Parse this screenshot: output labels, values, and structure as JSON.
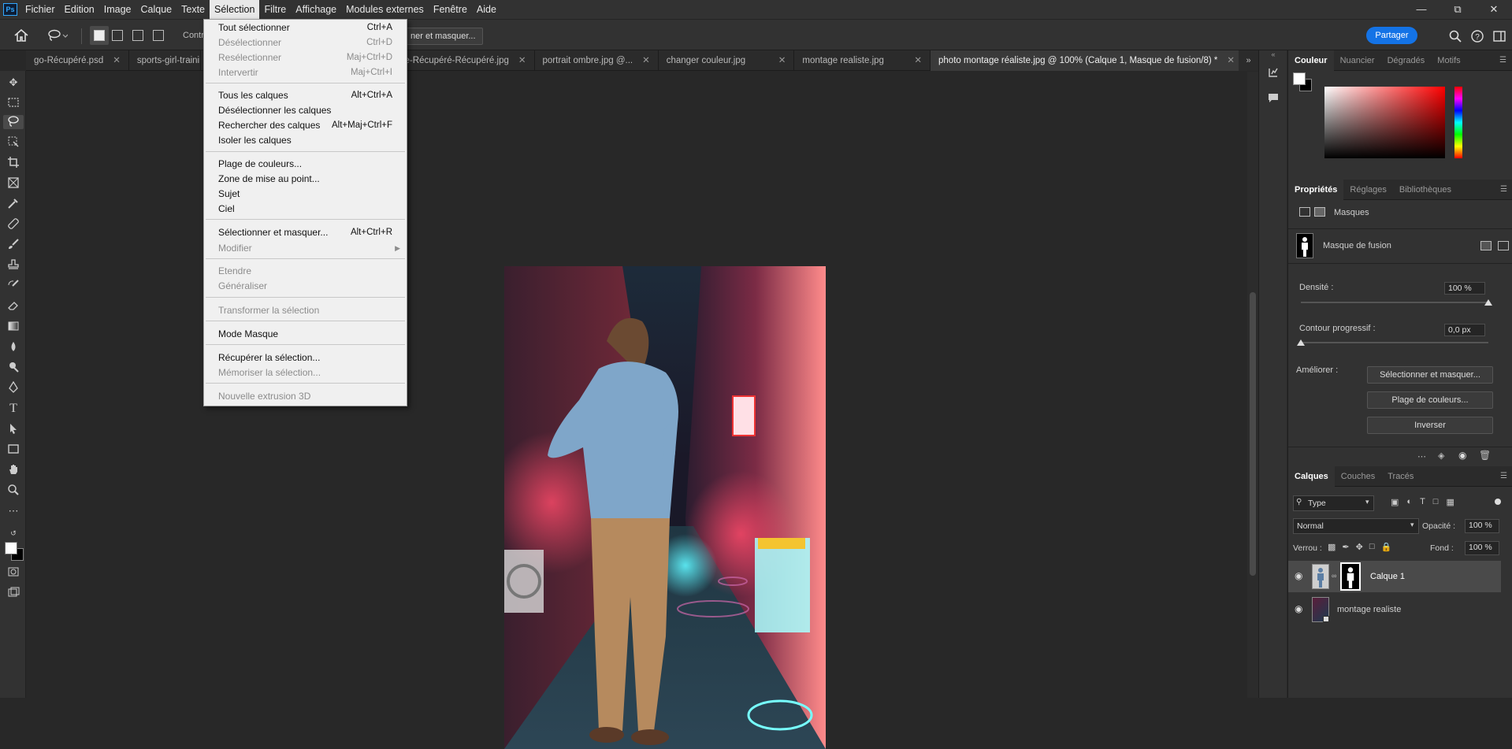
{
  "menubar": {
    "logo": "Ps",
    "items": [
      "Fichier",
      "Edition",
      "Image",
      "Calque",
      "Texte",
      "Sélection",
      "Filtre",
      "Affichage",
      "Modules externes",
      "Fenêtre",
      "Aide"
    ],
    "active_index": 5
  },
  "options": {
    "contour_label": "Contr",
    "select_mask_label": "ner et masquer...",
    "share_label": "Partager"
  },
  "tabs": [
    {
      "label": "go-Récupéré.psd"
    },
    {
      "label": "sports-girl-trainin"
    },
    {
      "label": "re-Récupéré-Récupéré.jpg"
    },
    {
      "label": "portrait ombre.jpg @..."
    },
    {
      "label": "changer couleur.jpg"
    },
    {
      "label": "montage realiste.jpg"
    },
    {
      "label": "photo montage réaliste.jpg @ 100% (Calque 1, Masque de fusion/8) *",
      "active": true
    }
  ],
  "selection_menu": {
    "items": [
      {
        "label": "Tout sélectionner",
        "shortcut": "Ctrl+A",
        "disabled": false
      },
      {
        "label": "Désélectionner",
        "shortcut": "Ctrl+D",
        "disabled": true
      },
      {
        "label": "Resélectionner",
        "shortcut": "Maj+Ctrl+D",
        "disabled": true
      },
      {
        "label": "Intervertir",
        "shortcut": "Maj+Ctrl+I",
        "disabled": true
      },
      {
        "label": "Tous les calques",
        "shortcut": "Alt+Ctrl+A",
        "disabled": false
      },
      {
        "label": "Désélectionner les calques",
        "shortcut": "",
        "disabled": false
      },
      {
        "label": "Rechercher des calques",
        "shortcut": "Alt+Maj+Ctrl+F",
        "disabled": false
      },
      {
        "label": "Isoler les calques",
        "shortcut": "",
        "disabled": false
      },
      {
        "label": "Plage de couleurs...",
        "shortcut": "",
        "disabled": false
      },
      {
        "label": "Zone de mise au point...",
        "shortcut": "",
        "disabled": false
      },
      {
        "label": "Sujet",
        "shortcut": "",
        "disabled": false
      },
      {
        "label": "Ciel",
        "shortcut": "",
        "disabled": false
      },
      {
        "label": "Sélectionner et masquer...",
        "shortcut": "Alt+Ctrl+R",
        "disabled": false
      },
      {
        "label": "Modifier",
        "shortcut": "",
        "disabled": true
      },
      {
        "label": "Etendre",
        "shortcut": "",
        "disabled": true
      },
      {
        "label": "Généraliser",
        "shortcut": "",
        "disabled": true
      },
      {
        "label": "Transformer la sélection",
        "shortcut": "",
        "disabled": true
      },
      {
        "label": "Mode Masque",
        "shortcut": "",
        "disabled": false
      },
      {
        "label": "Récupérer la sélection...",
        "shortcut": "",
        "disabled": false
      },
      {
        "label": "Mémoriser la sélection...",
        "shortcut": "",
        "disabled": true
      },
      {
        "label": "Nouvelle extrusion 3D",
        "shortcut": "",
        "disabled": true
      }
    ]
  },
  "color_panel": {
    "tabs": [
      "Couleur",
      "Nuancier",
      "Dégradés",
      "Motifs"
    ]
  },
  "properties_panel": {
    "tabs": [
      "Propriétés",
      "Réglages",
      "Bibliothèques"
    ],
    "masks_label": "Masques",
    "mask_name": "Masque de fusion",
    "density_label": "Densité :",
    "density_value": "100 %",
    "density_fraction": 1.0,
    "feather_label": "Contour progressif :",
    "feather_value": "0,0 px",
    "feather_fraction": 0.0,
    "improve_label": "Améliorer :",
    "btn_select_mask": "Sélectionner et masquer...",
    "btn_color_range": "Plage de couleurs...",
    "btn_invert": "Inverser"
  },
  "layers_panel": {
    "tabs": [
      "Calques",
      "Couches",
      "Tracés"
    ],
    "filter_label": "Type",
    "blend_mode": "Normal",
    "opacity_label": "Opacité :",
    "opacity_value": "100 %",
    "lock_label": "Verrou :",
    "fill_label": "Fond :",
    "fill_value": "100 %",
    "layers": [
      {
        "name": "Calque 1",
        "selected": true
      },
      {
        "name": "montage realiste",
        "selected": false
      }
    ]
  },
  "colors": {
    "accent": "#1473e6",
    "menu_bg": "#f0f0f0",
    "app_bg": "#282828"
  }
}
